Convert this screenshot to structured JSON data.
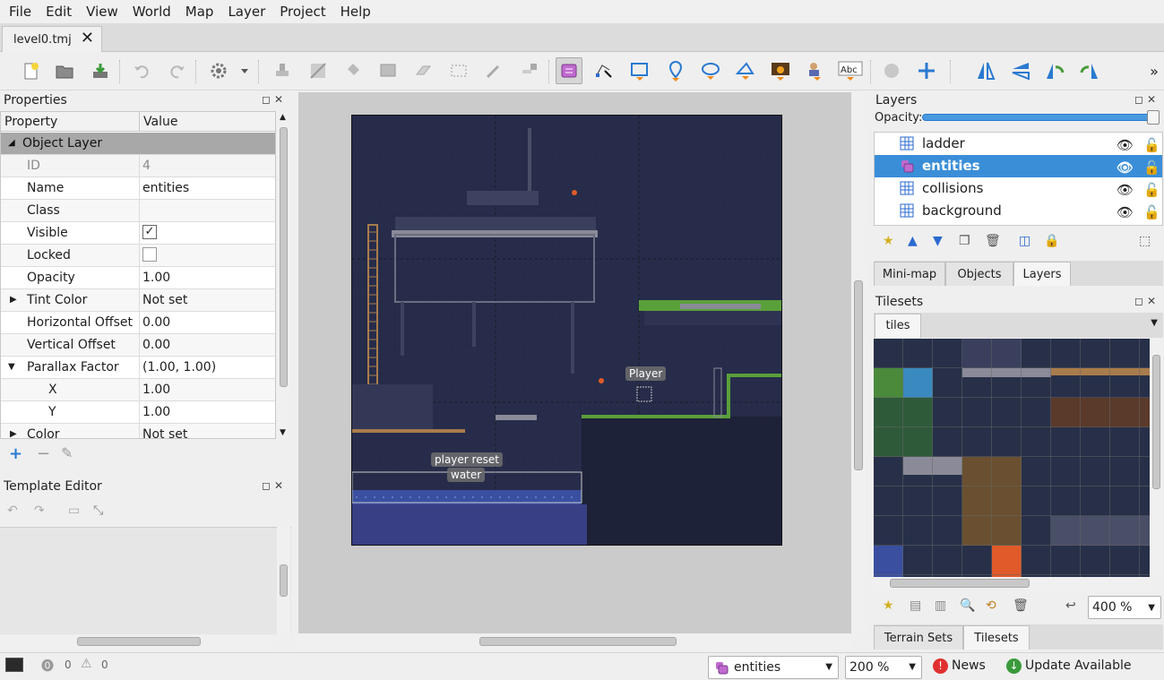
{
  "menubar": [
    "File",
    "Edit",
    "View",
    "World",
    "Map",
    "Layer",
    "Project",
    "Help"
  ],
  "document_tab": {
    "label": "level0.tmj",
    "close": "✕"
  },
  "properties": {
    "title": "Properties",
    "col_property": "Property",
    "col_value": "Value",
    "group": "Object Layer",
    "rows": [
      {
        "key": "ID",
        "value": "4"
      },
      {
        "key": "Name",
        "value": "entities"
      },
      {
        "key": "Class",
        "value": ""
      },
      {
        "key": "Visible",
        "value": "✓"
      },
      {
        "key": "Locked",
        "value": ""
      },
      {
        "key": "Opacity",
        "value": "1.00"
      },
      {
        "key": "Tint Color",
        "value": "Not set"
      },
      {
        "key": "Horizontal Offset",
        "value": "0.00"
      },
      {
        "key": "Vertical Offset",
        "value": "0.00"
      },
      {
        "key": "Parallax Factor",
        "value": "(1.00, 1.00)"
      },
      {
        "key": "X",
        "value": "1.00"
      },
      {
        "key": "Y",
        "value": "1.00"
      },
      {
        "key": "Color",
        "value": "Not set"
      }
    ]
  },
  "template_editor": {
    "title": "Template Editor"
  },
  "map_labels": {
    "player": "Player",
    "player_reset": "player reset",
    "water": "water"
  },
  "layers": {
    "title": "Layers",
    "opacity_label": "Opacity:",
    "opacity_value": 1.0,
    "items": [
      {
        "name": "ladder",
        "type": "tile"
      },
      {
        "name": "entities",
        "type": "object",
        "selected": true
      },
      {
        "name": "collisions",
        "type": "tile"
      },
      {
        "name": "background",
        "type": "tile"
      }
    ]
  },
  "top_right_tabs": [
    "Mini-map",
    "Objects",
    "Layers"
  ],
  "tilesets": {
    "title": "Tilesets",
    "tab": "tiles",
    "zoom": "400 %"
  },
  "bottom_right_tabs": [
    "Terrain Sets",
    "Tilesets"
  ],
  "status": {
    "errors": "0",
    "warnings": "0",
    "current_layer": "entities",
    "zoom": "200 %",
    "news": "News",
    "update": "Update Available"
  },
  "colors": {
    "selection": "#3a8ed8",
    "map_bg": "#272c4a",
    "water": "#3a4fa0",
    "grass": "#5aa03a"
  }
}
